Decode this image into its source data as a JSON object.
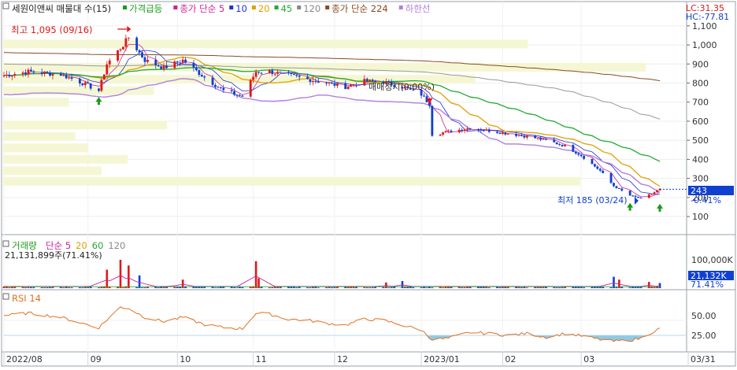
{
  "header": {
    "title": "세원이앤씨 매물대 수(15)",
    "legend": [
      {
        "label": "가격급등",
        "color": "#1a9c1a"
      },
      {
        "label": "종가 단순 5",
        "color": "#cc2299"
      },
      {
        "label": "10",
        "color": "#2233cc"
      },
      {
        "label": "20",
        "color": "#e0a000"
      },
      {
        "label": "45",
        "color": "#22aa33"
      },
      {
        "label": "120",
        "color": "#888888"
      },
      {
        "label": "종가 단순 224",
        "color": "#8b4a20"
      },
      {
        "label": "하한선",
        "color": "#b080e0"
      }
    ],
    "lc": "LC:31.35",
    "hc": "HC:-77.81"
  },
  "annotations": {
    "high_label": "최고 1,095 (09/16)",
    "low_label": "최저 185 (03/24)",
    "trade_halt": "매매정지(0.00%)",
    "last_price": "243",
    "last_change": "-0.41%"
  },
  "volume_panel": {
    "title": "거래량",
    "legend": [
      {
        "label": "단순 5",
        "color": "#cc2299"
      },
      {
        "label": "20",
        "color": "#e0a000"
      },
      {
        "label": "60",
        "color": "#22aa33"
      },
      {
        "label": "120",
        "color": "#888888"
      }
    ],
    "info": "21,131,899주(71.41%)",
    "tick": "100,000K",
    "last_value": "21,132K",
    "last_pct": "71.41%"
  },
  "rsi_panel": {
    "title": "RSI 14",
    "ticks": [
      "50.00",
      "25.00"
    ]
  },
  "colors": {
    "up": "#e01818",
    "down": "#1040d0",
    "volume_zone": "#f5f7d4",
    "rsi_line": "#e07020",
    "rsi_fill": "#8ecae6",
    "highlight": "#1040d0"
  },
  "chart_data": {
    "type": "candlestick",
    "x_axis_labels": [
      {
        "label": "2022/08",
        "date": "2022-08-01"
      },
      {
        "label": "09",
        "date": "2022-09-01"
      },
      {
        "label": "10",
        "date": "2022-10-04"
      },
      {
        "label": "11",
        "date": "2022-11-01"
      },
      {
        "label": "12",
        "date": "2022-12-01"
      },
      {
        "label": "2023/01",
        "date": "2023-01-02"
      },
      {
        "label": "02",
        "date": "2023-02-01"
      },
      {
        "label": "03",
        "date": "2023-03-02"
      },
      {
        "label": "03/31",
        "date": "2023-03-31"
      }
    ],
    "y_ticks": [
      "1,100",
      "1,000",
      "900",
      "800",
      "700",
      "600",
      "500",
      "400",
      "300",
      "200",
      "100"
    ],
    "y_range": [
      30,
      1120
    ],
    "price_anchors": [
      [
        "2022-08-01",
        840
      ],
      [
        "2022-08-10",
        860
      ],
      [
        "2022-08-22",
        845
      ],
      [
        "2022-08-30",
        800
      ],
      [
        "2022-09-05",
        760
      ],
      [
        "2022-09-08",
        900
      ],
      [
        "2022-09-14",
        1000
      ],
      [
        "2022-09-16",
        1040
      ],
      [
        "2022-09-22",
        920
      ],
      [
        "2022-09-29",
        880
      ],
      [
        "2022-10-06",
        920
      ],
      [
        "2022-10-14",
        830
      ],
      [
        "2022-10-21",
        760
      ],
      [
        "2022-10-28",
        730
      ],
      [
        "2022-11-02",
        860
      ],
      [
        "2022-11-07",
        860
      ],
      [
        "2022-11-14",
        840
      ],
      [
        "2022-11-21",
        820
      ],
      [
        "2022-11-28",
        800
      ],
      [
        "2022-12-05",
        780
      ],
      [
        "2022-12-12",
        810
      ],
      [
        "2022-12-19",
        805
      ],
      [
        "2022-12-26",
        780
      ],
      [
        "2023-01-02",
        740
      ],
      [
        "2023-01-05",
        690
      ],
      [
        "2023-01-06",
        530
      ],
      [
        "2023-01-12",
        545
      ],
      [
        "2023-01-20",
        565
      ],
      [
        "2023-01-27",
        550
      ],
      [
        "2023-02-03",
        535
      ],
      [
        "2023-02-10",
        520
      ],
      [
        "2023-02-17",
        500
      ],
      [
        "2023-02-24",
        470
      ],
      [
        "2023-03-02",
        420
      ],
      [
        "2023-03-09",
        340
      ],
      [
        "2023-03-14",
        260
      ],
      [
        "2023-03-20",
        210
      ],
      [
        "2023-03-24",
        195
      ],
      [
        "2023-03-28",
        220
      ],
      [
        "2023-03-31",
        243
      ]
    ],
    "high": {
      "date": "2022-09-16",
      "value": 1095
    },
    "low": {
      "date": "2023-03-24",
      "value": 185
    },
    "trade_halt_date": "2023-01-05",
    "last": {
      "date": "2023-03-31",
      "value": 243,
      "change_pct": -0.41
    },
    "volume_profile": [
      {
        "price": 1005,
        "length": 0.8
      },
      {
        "price": 883,
        "length": 0.98
      },
      {
        "price": 820,
        "length": 0.72
      },
      {
        "price": 760,
        "length": 0.23
      },
      {
        "price": 700,
        "length": 0.1
      },
      {
        "price": 580,
        "length": 0.25
      },
      {
        "price": 520,
        "length": 0.11
      },
      {
        "price": 460,
        "length": 0.13
      },
      {
        "price": 400,
        "length": 0.19
      },
      {
        "price": 340,
        "length": 0.15
      },
      {
        "price": 285,
        "length": 0.88
      }
    ],
    "volume_spikes": [
      {
        "date": "2022-09-08",
        "value": 65,
        "dir": "up"
      },
      {
        "date": "2022-09-13",
        "value": 100,
        "dir": "up"
      },
      {
        "date": "2022-09-16",
        "value": 80,
        "dir": "up"
      },
      {
        "date": "2022-09-20",
        "value": 45,
        "dir": "down"
      },
      {
        "date": "2022-10-06",
        "value": 30,
        "dir": "up"
      },
      {
        "date": "2022-11-02",
        "value": 95,
        "dir": "up"
      },
      {
        "date": "2022-11-03",
        "value": 35,
        "dir": "up"
      },
      {
        "date": "2022-12-20",
        "value": 20,
        "dir": "up"
      },
      {
        "date": "2022-12-26",
        "value": 25,
        "dir": "down"
      },
      {
        "date": "2023-03-14",
        "value": 40,
        "dir": "down"
      },
      {
        "date": "2023-03-16",
        "value": 30,
        "dir": "up"
      },
      {
        "date": "2023-03-27",
        "value": 22,
        "dir": "up"
      },
      {
        "date": "2023-03-31",
        "value": 18,
        "dir": "down"
      }
    ],
    "rsi_anchors": [
      [
        "2022-08-01",
        58
      ],
      [
        "2022-08-10",
        62
      ],
      [
        "2022-08-22",
        55
      ],
      [
        "2022-08-30",
        45
      ],
      [
        "2022-09-05",
        38
      ],
      [
        "2022-09-13",
        72
      ],
      [
        "2022-09-16",
        70
      ],
      [
        "2022-09-22",
        55
      ],
      [
        "2022-09-29",
        48
      ],
      [
        "2022-10-06",
        55
      ],
      [
        "2022-10-14",
        43
      ],
      [
        "2022-10-21",
        38
      ],
      [
        "2022-10-28",
        36
      ],
      [
        "2022-11-02",
        62
      ],
      [
        "2022-11-07",
        60
      ],
      [
        "2022-11-14",
        52
      ],
      [
        "2022-11-21",
        50
      ],
      [
        "2022-11-28",
        45
      ],
      [
        "2022-12-05",
        42
      ],
      [
        "2022-12-12",
        52
      ],
      [
        "2022-12-19",
        50
      ],
      [
        "2022-12-26",
        42
      ],
      [
        "2023-01-02",
        34
      ],
      [
        "2023-01-06",
        18
      ],
      [
        "2023-01-12",
        20
      ],
      [
        "2023-01-20",
        30
      ],
      [
        "2023-01-27",
        28
      ],
      [
        "2023-02-03",
        25
      ],
      [
        "2023-02-10",
        28
      ],
      [
        "2023-02-17",
        22
      ],
      [
        "2023-02-24",
        28
      ],
      [
        "2023-03-02",
        24
      ],
      [
        "2023-03-09",
        18
      ],
      [
        "2023-03-14",
        15
      ],
      [
        "2023-03-20",
        17
      ],
      [
        "2023-03-24",
        20
      ],
      [
        "2023-03-28",
        30
      ],
      [
        "2023-03-31",
        36
      ]
    ],
    "rsi_ylim": [
      0,
      80
    ],
    "rsi_oversold": 25
  }
}
